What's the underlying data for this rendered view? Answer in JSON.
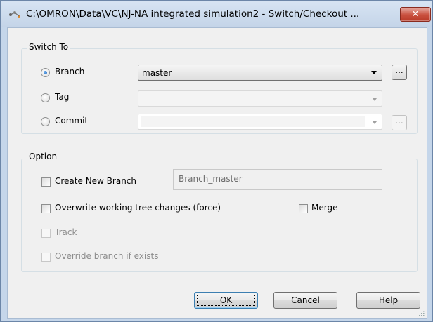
{
  "window": {
    "title": "C:\\OMRON\\Data\\VC\\NJ-NA integrated simulation2 - Switch/Checkout ...",
    "close_label": "✕"
  },
  "switch_to": {
    "legend": "Switch To",
    "branch": {
      "label": "Branch",
      "selected": true,
      "value": "master",
      "browse_label": "..."
    },
    "tag": {
      "label": "Tag",
      "selected": false,
      "value": ""
    },
    "commit": {
      "label": "Commit",
      "selected": false,
      "value": "",
      "browse_label": "..."
    }
  },
  "option": {
    "legend": "Option",
    "create_new_branch": {
      "label": "Create New Branch",
      "checked": false,
      "value": "Branch_master"
    },
    "overwrite": {
      "label": "Overwrite working tree changes (force)",
      "checked": false
    },
    "merge": {
      "label": "Merge",
      "checked": false
    },
    "track": {
      "label": "Track",
      "checked": false,
      "enabled": false
    },
    "override": {
      "label": "Override branch if exists",
      "checked": false,
      "enabled": false
    }
  },
  "buttons": {
    "ok": "OK",
    "cancel": "Cancel",
    "help": "Help"
  },
  "colors": {
    "frame": "#c5d6ea",
    "client": "#f0f0f0",
    "close": "#c9503e",
    "default_button": "#3c7fb1"
  }
}
